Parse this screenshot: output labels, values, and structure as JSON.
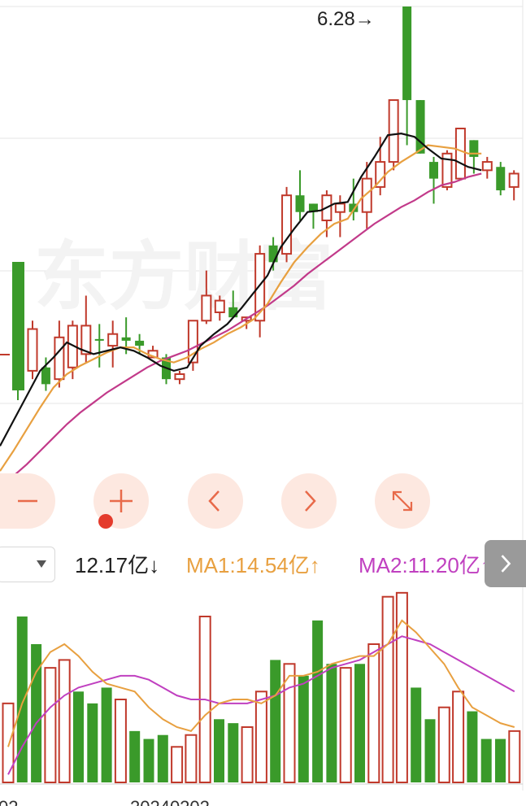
{
  "chart": {
    "max_price_annotation": "6.28→",
    "watermark": "东方财富"
  },
  "controls": {
    "zoom_out": "zoom-out",
    "zoom_in": "zoom-in",
    "prev": "previous",
    "next": "next",
    "fullscreen": "expand"
  },
  "volume_bar": {
    "selector_value": "",
    "current_volume": "12.17亿↓",
    "ma1": "MA1:14.54亿↑",
    "ma2": "MA2:11.20亿↑",
    "colors": {
      "current": "#222222",
      "ma1": "#e8a040",
      "ma2": "#c040c0"
    }
  },
  "axis": {
    "date_label_left": "02",
    "date_label_center": "20240202"
  },
  "colors": {
    "up": "#c0392b",
    "down": "#3a9a2a",
    "ma_short": "#111111",
    "ma_mid": "#e8a040",
    "ma_long": "#c23a8a"
  },
  "chart_data": {
    "type": "candlestick",
    "candles": [
      {
        "open": 4.1,
        "close": 4.35,
        "high": 4.4,
        "low": 4.05
      },
      {
        "open": 4.12,
        "close": 4.02,
        "high": 4.18,
        "low": 3.98
      },
      {
        "open": 4.05,
        "close": 4.3,
        "high": 4.4,
        "low": 4.0
      },
      {
        "open": 4.12,
        "close": 4.37,
        "high": 4.4,
        "low": 4.05
      },
      {
        "open": 4.2,
        "close": 4.37,
        "high": 4.55,
        "low": 4.15
      },
      {
        "open": 4.29,
        "close": 4.28,
        "high": 4.38,
        "low": 4.12
      },
      {
        "open": 4.25,
        "close": 4.32,
        "high": 4.4,
        "low": 4.12
      },
      {
        "open": 4.3,
        "close": 4.28,
        "high": 4.42,
        "low": 4.2
      },
      {
        "open": 4.28,
        "close": 4.25,
        "high": 4.32,
        "low": 4.2
      },
      {
        "open": 4.18,
        "close": 4.22,
        "high": 4.25,
        "low": 4.18
      },
      {
        "open": 4.18,
        "close": 4.05,
        "high": 4.2,
        "low": 4.02
      },
      {
        "open": 4.05,
        "close": 4.08,
        "high": 4.1,
        "low": 4.02
      },
      {
        "open": 4.15,
        "close": 4.4,
        "high": 4.4,
        "low": 4.1
      },
      {
        "open": 4.4,
        "close": 4.55,
        "high": 4.7,
        "low": 4.38
      },
      {
        "open": 4.45,
        "close": 4.52,
        "high": 4.55,
        "low": 4.4
      },
      {
        "open": 4.48,
        "close": 4.42,
        "high": 4.58,
        "low": 4.42
      },
      {
        "open": 4.4,
        "close": 4.42,
        "high": 4.42,
        "low": 4.35
      },
      {
        "open": 4.4,
        "close": 4.8,
        "high": 4.85,
        "low": 4.3
      },
      {
        "open": 4.85,
        "close": 4.75,
        "high": 4.9,
        "low": 4.7
      },
      {
        "open": 4.8,
        "close": 5.15,
        "high": 5.2,
        "low": 4.75
      },
      {
        "open": 5.15,
        "close": 5.05,
        "high": 5.3,
        "low": 5.0
      },
      {
        "open": 5.1,
        "close": 5.05,
        "high": 5.1,
        "low": 4.95
      },
      {
        "open": 5.0,
        "close": 5.15,
        "high": 5.18,
        "low": 4.9
      },
      {
        "open": 5.05,
        "close": 5.1,
        "high": 5.15,
        "low": 4.9
      },
      {
        "open": 5.1,
        "close": 5.05,
        "high": 5.25,
        "low": 5.0
      },
      {
        "open": 5.05,
        "close": 5.25,
        "high": 5.35,
        "low": 4.95
      },
      {
        "open": 5.2,
        "close": 5.35,
        "high": 5.5,
        "low": 5.15
      },
      {
        "open": 5.35,
        "close": 5.72,
        "high": 5.72,
        "low": 5.3
      },
      {
        "open": 6.28,
        "close": 5.72,
        "high": 6.28,
        "low": 5.45
      },
      {
        "open": 5.72,
        "close": 5.4,
        "high": 5.72,
        "low": 5.4
      },
      {
        "open": 5.35,
        "close": 5.25,
        "high": 5.38,
        "low": 5.1
      },
      {
        "open": 5.2,
        "close": 5.4,
        "high": 5.42,
        "low": 5.18
      },
      {
        "open": 5.25,
        "close": 5.55,
        "high": 5.55,
        "low": 5.25
      },
      {
        "open": 5.48,
        "close": 5.38,
        "high": 5.48,
        "low": 5.28
      },
      {
        "open": 5.3,
        "close": 5.35,
        "high": 5.38,
        "low": 5.25
      },
      {
        "open": 5.32,
        "close": 5.18,
        "high": 5.35,
        "low": 5.15
      },
      {
        "open": 5.2,
        "close": 5.28,
        "high": 5.3,
        "low": 5.12
      }
    ],
    "ma_short": [
      3.65,
      3.8,
      3.95,
      4.1,
      4.18,
      4.27,
      4.23,
      4.2,
      4.22,
      4.24,
      4.22,
      4.18,
      4.13,
      4.1,
      4.12,
      4.25,
      4.32,
      4.38,
      4.47,
      4.57,
      4.67,
      4.84,
      4.95,
      5.05,
      5.06,
      5.1,
      5.11,
      5.26,
      5.38,
      5.51,
      5.52,
      5.5,
      5.43,
      5.37,
      5.36,
      5.32,
      5.3
    ],
    "ma_mid": [
      3.5,
      3.62,
      3.75,
      3.88,
      4.0,
      4.08,
      4.13,
      4.17,
      4.21,
      4.24,
      4.24,
      4.2,
      4.17,
      4.15,
      4.18,
      4.23,
      4.27,
      4.32,
      4.36,
      4.41,
      4.5,
      4.63,
      4.75,
      4.84,
      4.92,
      4.98,
      5.01,
      5.13,
      5.2,
      5.29,
      5.35,
      5.4,
      5.45,
      5.44,
      5.43,
      5.4,
      5.4
    ],
    "ma_long": [
      3.4,
      3.47,
      3.54,
      3.62,
      3.7,
      3.78,
      3.85,
      3.91,
      3.97,
      4.02,
      4.07,
      4.12,
      4.16,
      4.19,
      4.22,
      4.26,
      4.3,
      4.34,
      4.39,
      4.44,
      4.49,
      4.55,
      4.61,
      4.68,
      4.74,
      4.8,
      4.86,
      4.92,
      4.98,
      5.03,
      5.08,
      5.12,
      5.17,
      5.21,
      5.23,
      5.26,
      5.28
    ],
    "volume": {
      "values": [
        10.0,
        21.0,
        17.5,
        14.5,
        15.5,
        11.5,
        10.0,
        12.0,
        10.5,
        6.5,
        5.5,
        6.0,
        4.5,
        6.0,
        21.0,
        8.0,
        7.5,
        7.0,
        11.5,
        15.5,
        15.0,
        13.5,
        20.5,
        15.0,
        14.5,
        15.0,
        17.5,
        23.5,
        24.0,
        12.0,
        8.0,
        9.5,
        11.5,
        9.0,
        5.5,
        5.5,
        6.5
      ],
      "up": [
        true,
        false,
        false,
        true,
        true,
        false,
        false,
        false,
        true,
        false,
        false,
        false,
        true,
        true,
        true,
        false,
        false,
        true,
        true,
        false,
        true,
        false,
        false,
        false,
        true,
        false,
        true,
        true,
        true,
        false,
        false,
        true,
        true,
        false,
        false,
        false,
        true
      ],
      "ma1": [
        4.5,
        10.0,
        14.0,
        16.5,
        17.5,
        16.0,
        14.0,
        12.5,
        12.0,
        11.5,
        9.5,
        8.0,
        7.0,
        6.5,
        8.5,
        10.0,
        10.5,
        10.5,
        10.0,
        11.0,
        13.5,
        13.5,
        14.0,
        15.0,
        15.5,
        16.0,
        16.0,
        17.5,
        20.5,
        19.0,
        17.0,
        15.0,
        12.0,
        9.5,
        8.5,
        7.5,
        7.0
      ],
      "ma2": [
        1.0,
        4.5,
        7.5,
        9.5,
        11.0,
        12.0,
        12.5,
        13.0,
        13.5,
        13.5,
        13.0,
        12.0,
        11.0,
        10.5,
        10.5,
        10.0,
        10.0,
        10.0,
        10.5,
        11.0,
        12.0,
        12.5,
        13.5,
        14.5,
        15.0,
        15.5,
        16.5,
        17.5,
        18.5,
        18.0,
        17.5,
        16.5,
        15.5,
        14.5,
        13.5,
        12.5,
        11.5
      ]
    }
  }
}
